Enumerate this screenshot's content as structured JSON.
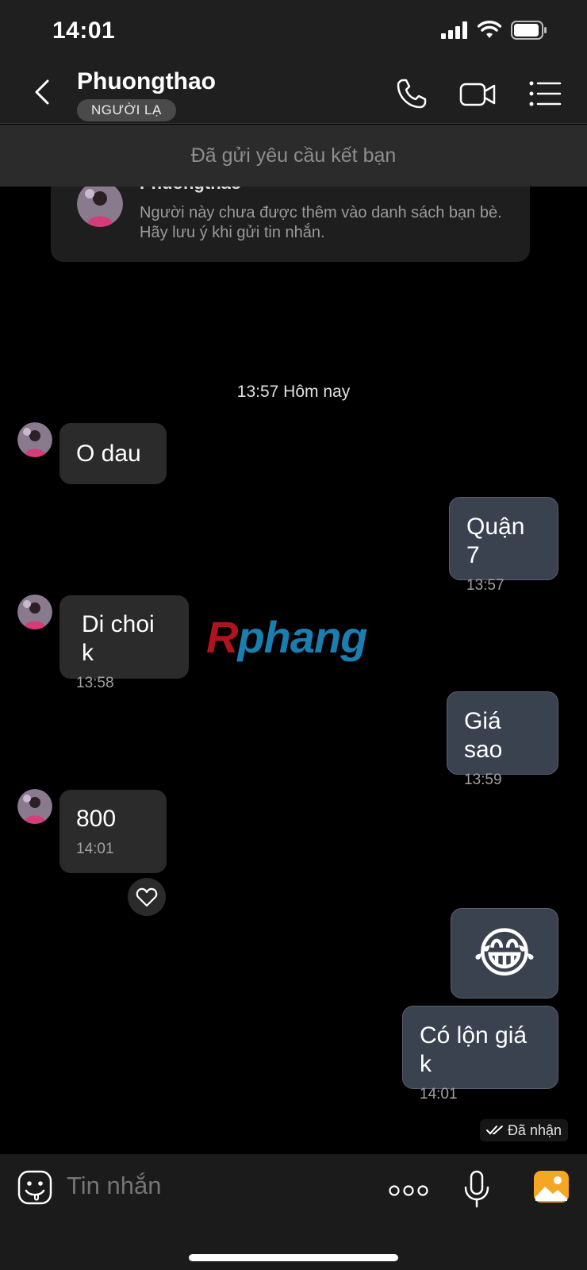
{
  "status_bar": {
    "time": "14:01"
  },
  "header": {
    "contact_name": "Phuongthao",
    "badge": "NGƯỜI LẠ",
    "icons": [
      "back-chevron",
      "phone",
      "video-camera",
      "list-menu"
    ]
  },
  "friend_request_banner": "Đã gửi yêu cầu kết bạn",
  "info_card": {
    "name": "Phuongthao",
    "text": "Người này chưa được thêm vào danh sách bạn bè. Hãy lưu ý khi gửi tin nhắn."
  },
  "time_separator": "13:57 Hôm nay",
  "messages": [
    {
      "direction": "in",
      "text": "O dau",
      "time": ""
    },
    {
      "direction": "out",
      "text": "Quận 7",
      "time": "13:57"
    },
    {
      "direction": "in",
      "text": "Di choi k",
      "time": "13:58"
    },
    {
      "direction": "out",
      "text": "Giá sao",
      "time": "13:59"
    },
    {
      "direction": "in",
      "text": "800",
      "time": "14:01"
    },
    {
      "direction": "out",
      "text": "😂",
      "time": ""
    },
    {
      "direction": "out",
      "text": "Có lộn giá k",
      "time": "14:01"
    }
  ],
  "read_status": "Đã nhận",
  "watermark": {
    "part1": "R",
    "part2": "phang"
  },
  "composer": {
    "placeholder": "Tin nhắn"
  },
  "colors": {
    "incoming_bubble": "#2b2b2b",
    "outgoing_bubble": "#3a4250",
    "accent_photo": "#f5a623"
  }
}
